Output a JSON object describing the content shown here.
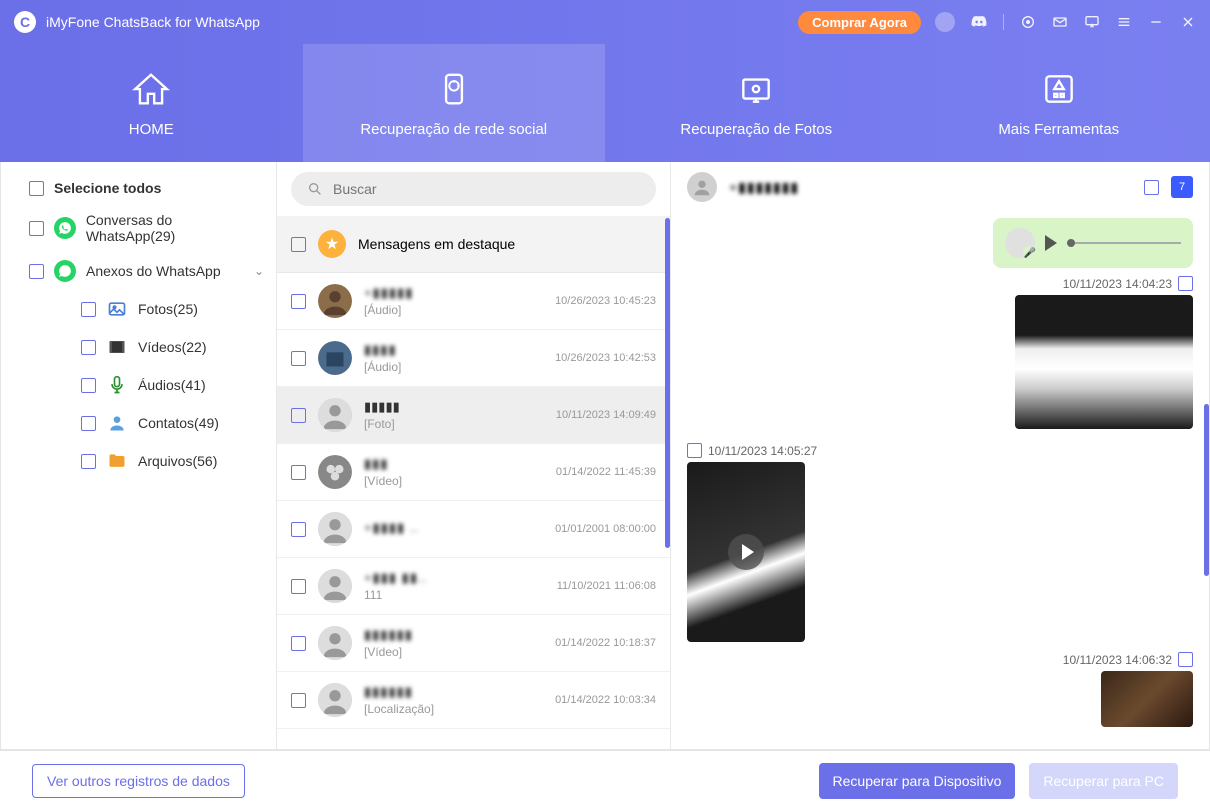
{
  "titlebar": {
    "app_name": "iMyFone ChatsBack for WhatsApp",
    "buy_now": "Comprar Agora"
  },
  "nav": {
    "home": "HOME",
    "social": "Recuperação de rede social",
    "photos": "Recuperação de Fotos",
    "tools": "Mais Ferramentas"
  },
  "sidebar": {
    "select_all": "Selecione todos",
    "conversations": "Conversas do WhatsApp(29)",
    "attachments": "Anexos do WhatsApp",
    "photos": "Fotos(25)",
    "videos": "Vídeos(22)",
    "audios": "Áudios(41)",
    "contacts": "Contatos(49)",
    "files": "Arquivos(56)"
  },
  "search_placeholder": "Buscar",
  "featured_label": "Mensagens em destaque",
  "chats": [
    {
      "name": "+▮▮▮▮▮",
      "sub": "[Áudio]",
      "time": "10/26/2023 10:45:23"
    },
    {
      "name": "▮▮▮▮",
      "sub": "[Áudio]",
      "time": "10/26/2023 10:42:53"
    },
    {
      "name": "▮▮▮▮▮",
      "sub": "[Foto]",
      "time": "10/11/2023 14:09:49"
    },
    {
      "name": "▮▮▮",
      "sub": "[Vídeo]",
      "time": "01/14/2022 11:45:39"
    },
    {
      "name": "+▮▮▮▮ ..",
      "sub": " ",
      "time": "01/01/2001 08:00:00"
    },
    {
      "name": "+▮▮▮ ▮▮..",
      "sub": "111",
      "time": "11/10/2021 11:06:08"
    },
    {
      "name": "▮▮▮▮▮▮",
      "sub": "[Vídeo]",
      "time": "01/14/2022 10:18:37"
    },
    {
      "name": "▮▮▮▮▮▮",
      "sub": "[Localização]",
      "time": "01/14/2022 10:03:34"
    }
  ],
  "chat_header_name": "+▮▮▮▮▮▮▮",
  "calendar_num": "7",
  "messages": {
    "m1_time": "10/11/2023 14:04:23",
    "m2_time": "10/11/2023 14:05:27",
    "m3_time": "10/11/2023 14:06:32"
  },
  "footer": {
    "other_records": "Ver outros registros de dados",
    "recover_device": "Recuperar para Dispositivo",
    "recover_pc": "Recuperar para PC"
  }
}
